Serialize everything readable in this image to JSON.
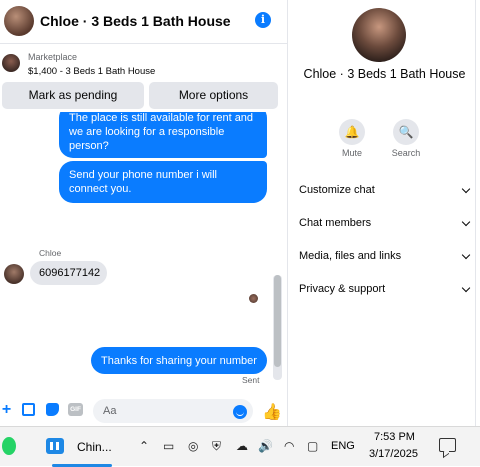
{
  "header": {
    "title": "Chloe · 3 Beds 1 Bath House",
    "info_icon": "info-icon"
  },
  "marketplace": {
    "label": "Marketplace",
    "listing": "$1,400 - 3 Beds 1 Bath House"
  },
  "actions": {
    "mark_pending": "Mark as pending",
    "more_options": "More options"
  },
  "messages": {
    "outgoing_1": "The place is still available for rent and we are looking for a responsible person?",
    "outgoing_2": "Send your phone number i will connect you.",
    "sender_name": "Chloe",
    "incoming_1": "6096177142",
    "outgoing_3": "Thanks for sharing your number",
    "status": "Sent"
  },
  "composer": {
    "placeholder": "Aa"
  },
  "panel": {
    "name": "Chloe · 3 Beds 1 Bath House",
    "mute_label": "Mute",
    "search_label": "Search",
    "sections": [
      "Customize chat",
      "Chat members",
      "Media, files and links",
      "Privacy & support"
    ]
  },
  "taskbar": {
    "app_label": "Chin...",
    "language": "ENG",
    "time": "7:53 PM",
    "date": "3/17/2025"
  },
  "colors": {
    "accent": "#0a7cff",
    "bubble_in": "#e4e6eb"
  }
}
